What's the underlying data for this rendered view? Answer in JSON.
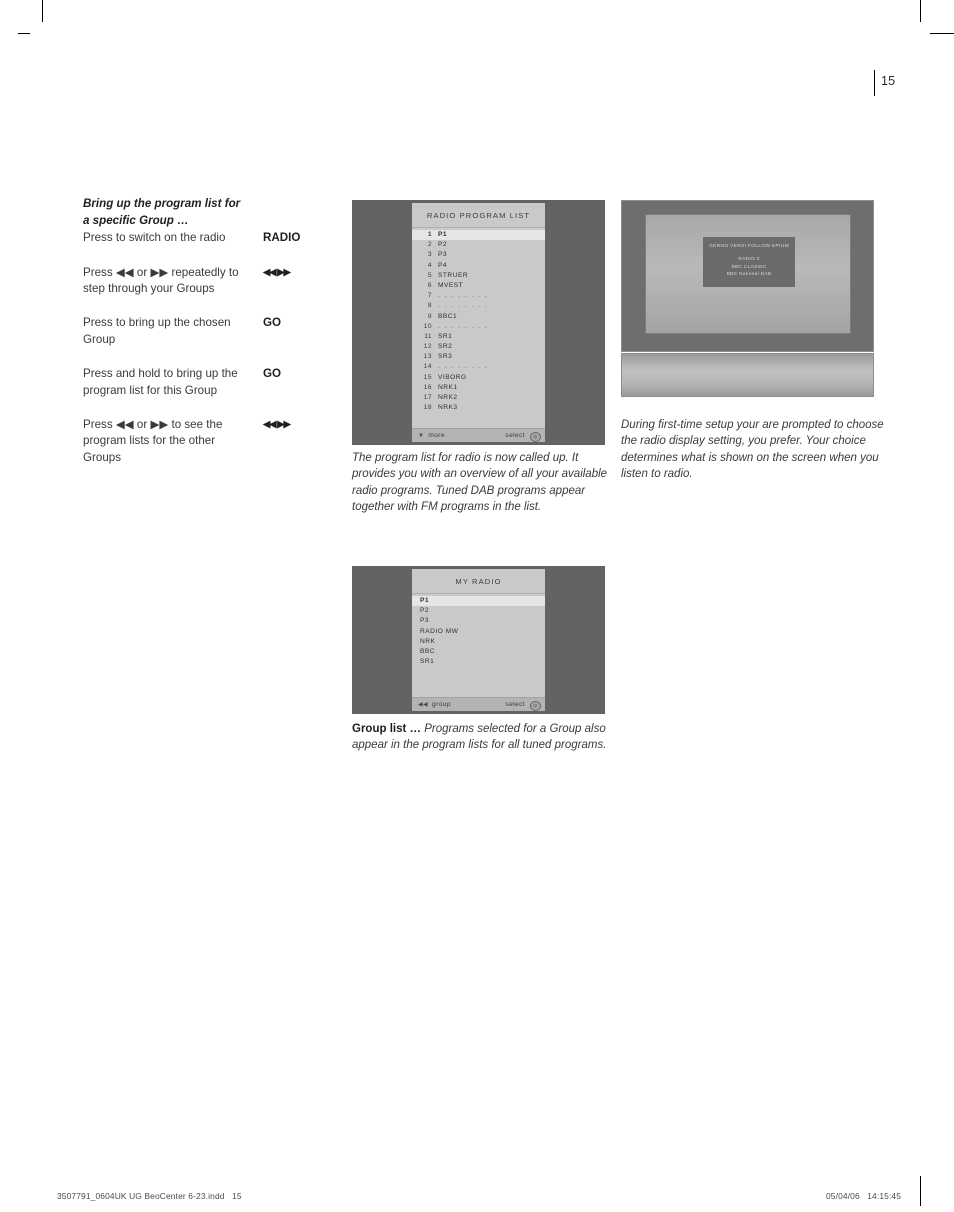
{
  "page": {
    "number": "15",
    "footer_left": "3507791_0604UK UG BeoCenter 6-23.indd   15",
    "footer_right": "05/04/06   14:15:45"
  },
  "instructions": {
    "title_line1": "Bring up the program list for",
    "title_line2": "a specific Group …",
    "rows": [
      {
        "text": "Press to switch on the radio",
        "key": "RADIO",
        "key_type": "text"
      },
      {
        "text": "Press ◀◀ or ▶▶ repeatedly to step through your Groups",
        "key": "◀◀ ▶▶",
        "key_type": "glyph"
      },
      {
        "text": "Press to bring up the chosen Group",
        "key": "GO",
        "key_type": "text"
      },
      {
        "text": "Press and hold to bring up the program list for this Group",
        "key": "GO",
        "key_type": "text"
      },
      {
        "text": "Press ◀◀ or ▶▶ to see the program lists for the other Groups",
        "key": "◀◀ ▶▶",
        "key_type": "glyph"
      }
    ]
  },
  "radio_program_list": {
    "title": "RADIO  PROGRAM  LIST",
    "rows": [
      {
        "num": "1",
        "name": "P1",
        "selected": true
      },
      {
        "num": "2",
        "name": "P2",
        "selected": false
      },
      {
        "num": "3",
        "name": "P3",
        "selected": false
      },
      {
        "num": "4",
        "name": "P4",
        "selected": false
      },
      {
        "num": "5",
        "name": "STRUER",
        "selected": false
      },
      {
        "num": "6",
        "name": "MVEST",
        "selected": false
      },
      {
        "num": "7",
        "name": ". . . . . . . .",
        "selected": false,
        "empty": true
      },
      {
        "num": "8",
        "name": ". . . . . . . .",
        "selected": false,
        "empty": true
      },
      {
        "num": "9",
        "name": "BBC1",
        "selected": false
      },
      {
        "num": "10",
        "name": ". . . . . . . .",
        "selected": false,
        "empty": true
      },
      {
        "num": "11",
        "name": "SR1",
        "selected": false
      },
      {
        "num": "12",
        "name": "SR2",
        "selected": false
      },
      {
        "num": "13",
        "name": "SR3",
        "selected": false
      },
      {
        "num": "14",
        "name": ". . . . . . . .",
        "selected": false,
        "empty": true
      },
      {
        "num": "15",
        "name": "VIBORG",
        "selected": false
      },
      {
        "num": "16",
        "name": "NRK1",
        "selected": false
      },
      {
        "num": "17",
        "name": "NRK2",
        "selected": false
      },
      {
        "num": "18",
        "name": "NRK3",
        "selected": false
      }
    ],
    "footer": {
      "left_glyph": "▼",
      "left_label": "more",
      "right_label": "select",
      "right_icon": "◎"
    },
    "caption": "The program list for radio is now called up. It provides you with an overview of all your available radio programs. Tuned DAB programs appear together with FM programs in the list."
  },
  "my_radio_list": {
    "title": "MY  RADIO",
    "rows": [
      {
        "name": "P1",
        "selected": true
      },
      {
        "name": "P2",
        "selected": false
      },
      {
        "name": "P3",
        "selected": false
      },
      {
        "name": "RADIO MW",
        "selected": false
      },
      {
        "name": "NRK",
        "selected": false
      },
      {
        "name": "BBC",
        "selected": false
      },
      {
        "name": "SR1",
        "selected": false
      }
    ],
    "footer": {
      "left_glyph": "◀◀",
      "left_label": "group",
      "right_label": "select",
      "right_icon": "◎"
    },
    "caption_bold": "Group list …",
    "caption_rest": " Programs selected for a Group also appear in the program lists for all tuned programs."
  },
  "tv_display": {
    "osd_header": "GERNO VERSI FOLLOW EPIUM",
    "osd_lines": [
      "RADIO  3",
      "BBC  CLASSIC",
      "BBC National DAB"
    ],
    "caption": "During first-time setup your are prompted to choose the radio display setting, you prefer. Your choice determines what is shown on the screen when you listen to radio."
  }
}
